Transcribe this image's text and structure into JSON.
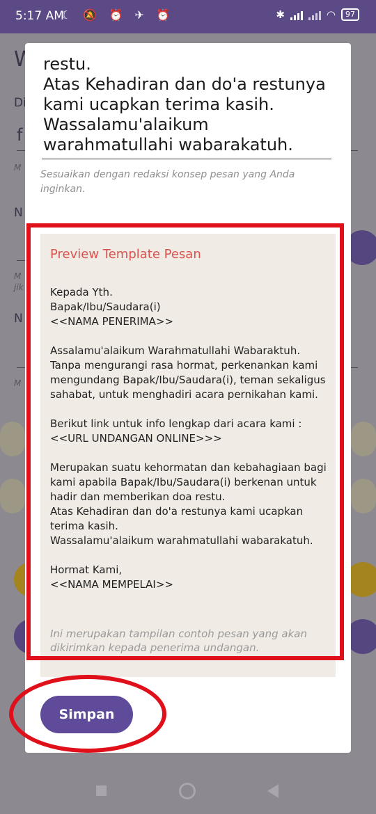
{
  "status_bar": {
    "time": "5:17 AM",
    "left_icons": "☾ 🔕 ⏰ ✈ ⏰",
    "battery": "97"
  },
  "background": {
    "title_initial": "W",
    "label_1": "Di",
    "value_1": "f",
    "hint_1": "M",
    "label_2": "N",
    "hint_2a": "M",
    "hint_2b": "jik",
    "label_3": "N",
    "hint_3": "M"
  },
  "dialog": {
    "message_text": "restu.\nAtas Kehadiran dan do'a restunya kami ucapkan terima kasih.\nWassalamu'alaikum warahmatullahi wabarakatuh.",
    "helper_text": "Sesuaikan dengan redaksi konsep pesan yang Anda inginkan.",
    "preview": {
      "title": "Preview Template Pesan",
      "body": "Kepada Yth.\nBapak/Ibu/Saudara(i)\n<<NAMA PENERIMA>>\n\nAssalamu'alaikum Warahmatullahi Wabaraktuh.\nTanpa mengurangi rasa hormat, perkenankan kami mengundang Bapak/Ibu/Saudara(i), teman sekaligus sahabat, untuk menghadiri acara pernikahan kami.\n\nBerikut link untuk info lengkap dari acara kami :\n<<URL UNDANGAN ONLINE>>>\n\nMerupakan suatu kehormatan dan kebahagiaan bagi kami apabila Bapak/Ibu/Saudara(i) berkenan untuk hadir dan memberikan doa restu.\nAtas Kehadiran dan do'a restunya kami ucapkan terima kasih.\nWassalamu'alaikum warahmatullahi wabarakatuh.\n\nHormat Kami,\n<<NAMA MEMPELAI>>",
      "footnote": "Ini merupakan tampilan contoh pesan yang akan dikirimkan kepada penerima undangan."
    },
    "save_label": "Simpan"
  },
  "colors": {
    "accent": "#5f4b99",
    "annotation": "#e0101b",
    "preview_title": "#d9534f",
    "preview_bg": "#f0ebe4"
  }
}
